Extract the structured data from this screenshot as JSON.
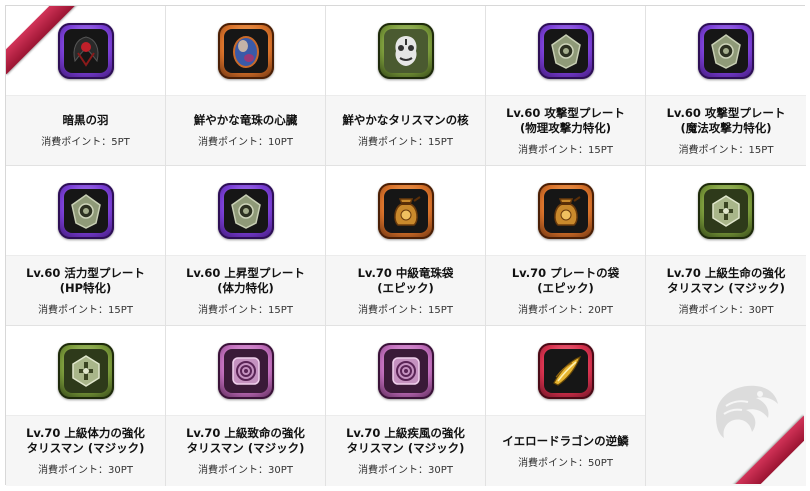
{
  "items": [
    {
      "name": "暗黒の羽",
      "points": "消費ポイント：5PT",
      "icon": "dark-wing-icon",
      "frame": "purple"
    },
    {
      "name": "鮮やかな竜珠の心臓",
      "points": "消費ポイント：10PT",
      "icon": "dragon-orb-heart-icon",
      "frame": "orange"
    },
    {
      "name": "鮮やかなタリスマンの核",
      "points": "消費ポイント：15PT",
      "icon": "talisman-core-icon",
      "frame": "green"
    },
    {
      "name": "Lv.60 攻撃型プレート\n(物理攻撃力特化)",
      "points": "消費ポイント：15PT",
      "icon": "attack-plate-icon",
      "frame": "purple"
    },
    {
      "name": "Lv.60 攻撃型プレート\n(魔法攻撃力特化)",
      "points": "消費ポイント：15PT",
      "icon": "magic-attack-plate-icon",
      "frame": "purple"
    },
    {
      "name": "Lv.60 活力型プレート\n(HP特化)",
      "points": "消費ポイント：15PT",
      "icon": "vitality-plate-icon",
      "frame": "purple"
    },
    {
      "name": "Lv.60 上昇型プレート\n(体力特化)",
      "points": "消費ポイント：15PT",
      "icon": "rising-plate-icon",
      "frame": "purple"
    },
    {
      "name": "Lv.70 中級竜珠袋\n(エピック)",
      "points": "消費ポイント：15PT",
      "icon": "dragon-orb-pouch-icon",
      "frame": "orange"
    },
    {
      "name": "Lv.70 プレートの袋\n(エピック)",
      "points": "消費ポイント：20PT",
      "icon": "plate-pouch-icon",
      "frame": "orange"
    },
    {
      "name": "Lv.70 上級生命の強化\nタリスマン (マジック)",
      "points": "消費ポイント：30PT",
      "icon": "life-talisman-icon",
      "frame": "green"
    },
    {
      "name": "Lv.70 上級体力の強化\nタリスマン (マジック)",
      "points": "消費ポイント：30PT",
      "icon": "stamina-talisman-icon",
      "frame": "green"
    },
    {
      "name": "Lv.70 上級致命の強化\nタリスマン (マジック)",
      "points": "消費ポイント：30PT",
      "icon": "critical-talisman-icon",
      "frame": "pink"
    },
    {
      "name": "Lv.70 上級疾風の強化\nタリスマン (マジック)",
      "points": "消費ポイント：30PT",
      "icon": "gale-talisman-icon",
      "frame": "pink"
    },
    {
      "name": "イエロードラゴンの逆鱗",
      "points": "消費ポイント：50PT",
      "icon": "yellow-dragon-scale-icon",
      "frame": "pink"
    }
  ],
  "decor": {
    "watermark_icon": "dragon-watermark-icon",
    "ribbon_color": "#c0264a"
  }
}
